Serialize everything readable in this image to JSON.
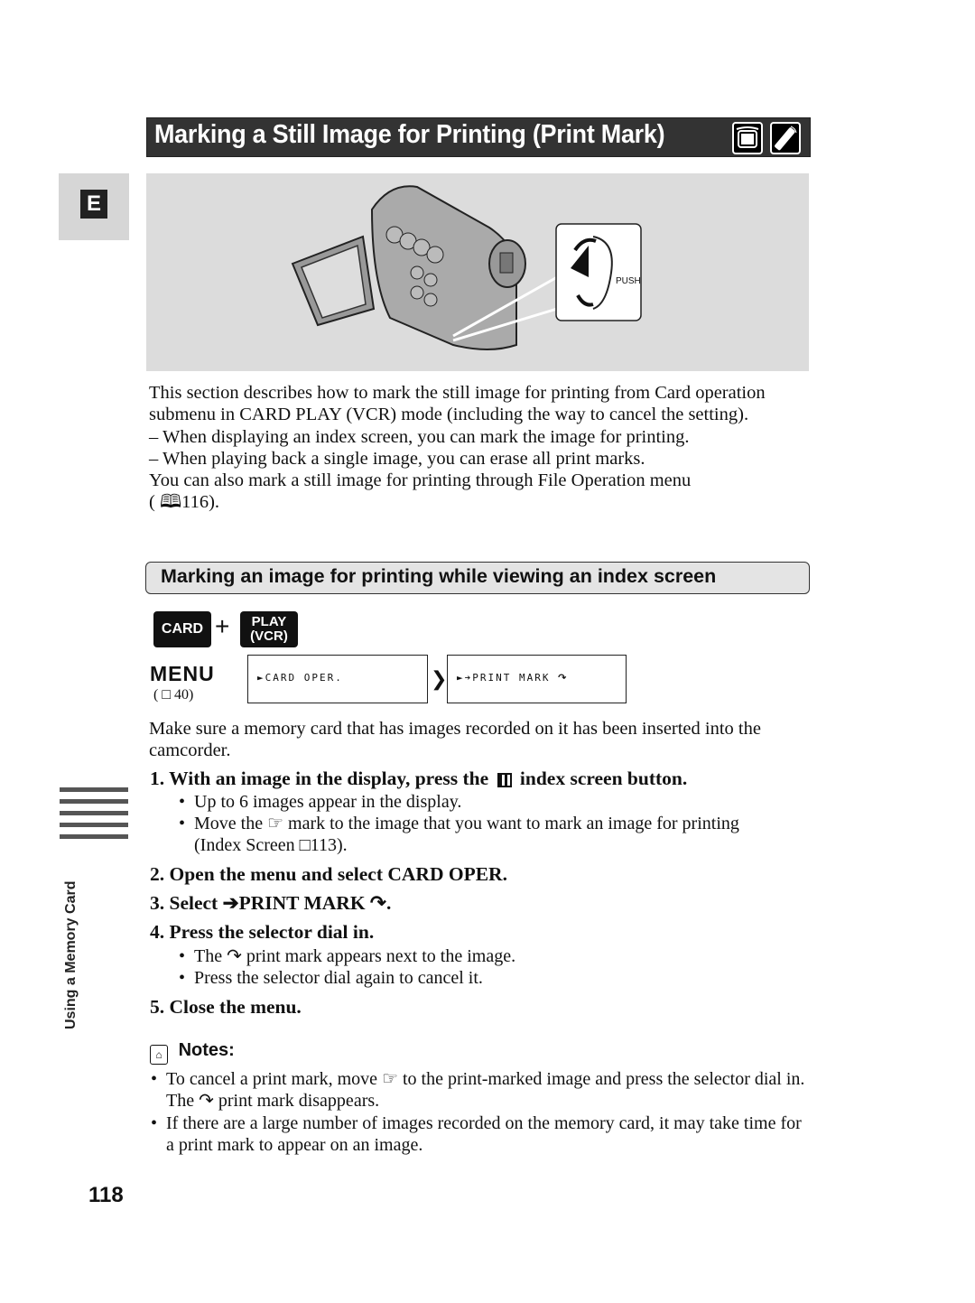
{
  "header": {
    "title": "Marking a Still Image for Printing (Print Mark)",
    "icons": [
      "camcorder-icon",
      "remote-control-icon"
    ]
  },
  "language_tab": "E",
  "figure": {
    "description": "Camcorder with open LCD panel; inset showing selector dial",
    "dial_label": "PUSH"
  },
  "intro": {
    "paragraph": "This section describes how to mark the still image for printing from Card operation submenu in CARD PLAY (VCR) mode (including the way to cancel the setting).",
    "dash_items": [
      "– When displaying an index screen, you can mark the image for printing.",
      "– When playing back a single image, you can erase all print marks."
    ],
    "also": "You can also mark a still image for printing through File Operation menu",
    "also_ref": "( 🕮116)."
  },
  "subheading": "Marking an image for printing while viewing an index screen",
  "mode": {
    "card": "CARD",
    "plus": "+",
    "play_line1": "PLAY",
    "play_line2": "(VCR)"
  },
  "menu": {
    "label": "MENU",
    "ref": "( □ 40)",
    "box1": "►CARD OPER.",
    "arrow": "❯",
    "box2": "►➔PRINT MARK"
  },
  "prereq": "Make sure a memory card that has images recorded on it has been inserted into the camcorder.",
  "steps": [
    {
      "num": "1.",
      "text_a": "With an image in the display, press the",
      "text_b": "index screen button.",
      "bullets": [
        "Up to 6 images appear in the display.",
        "Move the ☞ mark to the image that you want to mark an image for printing (Index Screen □113)."
      ]
    },
    {
      "num": "2.",
      "text": "Open the menu and select CARD OPER.",
      "bullets": []
    },
    {
      "num": "3.",
      "text": "Select ➔PRINT MARK ↷.",
      "bullets": []
    },
    {
      "num": "4.",
      "text": "Press the selector dial in.",
      "bullets": [
        "The ↷ print mark appears next to the image.",
        "Press the selector dial again to cancel it."
      ]
    },
    {
      "num": "5.",
      "text": "Close the menu.",
      "bullets": []
    }
  ],
  "side": {
    "label": "Using a Memory Card"
  },
  "notes": {
    "title": "Notes:",
    "items": [
      "To cancel a print mark, move ☞ to the print-marked image and press the selector dial in. The ↷ print mark disappears.",
      "If there are a large number of images recorded on the memory card, it may take time for a print mark to appear on an image."
    ]
  },
  "page_number": "118"
}
